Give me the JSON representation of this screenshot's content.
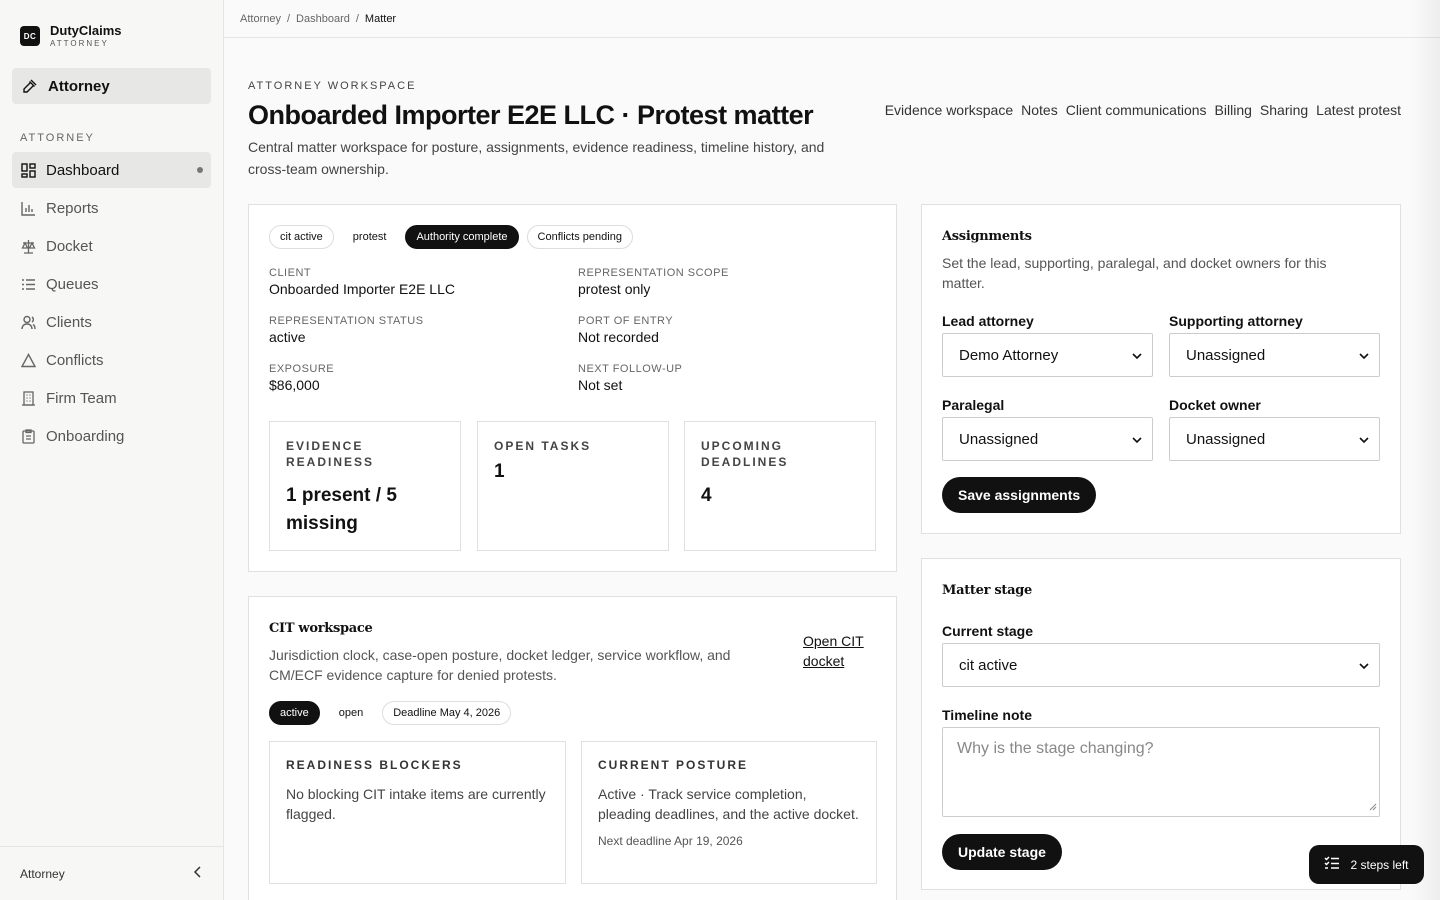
{
  "brand": {
    "logo": "DC",
    "name": "DutyClaims",
    "sub": "ATTORNEY"
  },
  "sidebar": {
    "top_item": "Attorney",
    "section_label": "ATTORNEY",
    "items": [
      {
        "label": "Dashboard",
        "icon": "dashboard-icon",
        "active": true
      },
      {
        "label": "Reports",
        "icon": "bar-chart-icon"
      },
      {
        "label": "Docket",
        "icon": "scale-icon"
      },
      {
        "label": "Queues",
        "icon": "list-icon"
      },
      {
        "label": "Clients",
        "icon": "users-icon"
      },
      {
        "label": "Conflicts",
        "icon": "warning-icon"
      },
      {
        "label": "Firm Team",
        "icon": "building-icon"
      },
      {
        "label": "Onboarding",
        "icon": "clipboard-icon"
      }
    ],
    "footer_label": "Attorney"
  },
  "breadcrumb": [
    "Attorney",
    "Dashboard",
    "Matter"
  ],
  "header": {
    "eyebrow": "ATTORNEY WORKSPACE",
    "title": "Onboarded Importer E2E LLC · Protest matter",
    "description": "Central matter workspace for posture, assignments, evidence readiness, timeline history, and cross-team ownership.",
    "tabs": [
      "Evidence workspace",
      "Notes",
      "Client communications",
      "Billing",
      "Sharing",
      "Latest protest"
    ]
  },
  "summary": {
    "pills": [
      "cit active",
      "protest",
      "Authority complete",
      "Conflicts pending"
    ],
    "fields": [
      {
        "label": "CLIENT",
        "value": "Onboarded Importer E2E LLC"
      },
      {
        "label": "REPRESENTATION SCOPE",
        "value": "protest only"
      },
      {
        "label": "REPRESENTATION STATUS",
        "value": "active"
      },
      {
        "label": "PORT OF ENTRY",
        "value": "Not recorded"
      },
      {
        "label": "EXPOSURE",
        "value": "$86,000"
      },
      {
        "label": "NEXT FOLLOW-UP",
        "value": "Not set"
      }
    ],
    "stats": [
      {
        "label": "EVIDENCE READINESS",
        "value": "1 present / 5 missing"
      },
      {
        "label": "OPEN TASKS",
        "value": "1"
      },
      {
        "label": "UPCOMING DEADLINES",
        "value": "4"
      }
    ]
  },
  "cit": {
    "title": "CIT workspace",
    "description": "Jurisdiction clock, case-open posture, docket ledger, service workflow, and CM/ECF evidence capture for denied protests.",
    "link": "Open CIT docket",
    "pills": [
      "active",
      "open",
      "Deadline May 4, 2026"
    ],
    "blockers_label": "READINESS BLOCKERS",
    "blockers_text": "No blocking CIT intake items are currently flagged.",
    "posture_label": "CURRENT POSTURE",
    "posture_text": "Active · Track service completion, pleading deadlines, and the active docket.",
    "posture_deadline": "Next deadline Apr 19, 2026"
  },
  "assignments": {
    "title": "Assignments",
    "description": "Set the lead, supporting, paralegal, and docket owners for this matter.",
    "lead_label": "Lead attorney",
    "lead_value": "Demo Attorney",
    "supporting_label": "Supporting attorney",
    "supporting_value": "Unassigned",
    "paralegal_label": "Paralegal",
    "paralegal_value": "Unassigned",
    "docket_label": "Docket owner",
    "docket_value": "Unassigned",
    "save": "Save assignments"
  },
  "stage": {
    "title": "Matter stage",
    "current_label": "Current stage",
    "current_value": "cit active",
    "note_label": "Timeline note",
    "note_placeholder": "Why is the stage changing?",
    "update": "Update stage"
  },
  "toast": {
    "label": "2 steps left",
    "icon": "checklist-icon"
  }
}
